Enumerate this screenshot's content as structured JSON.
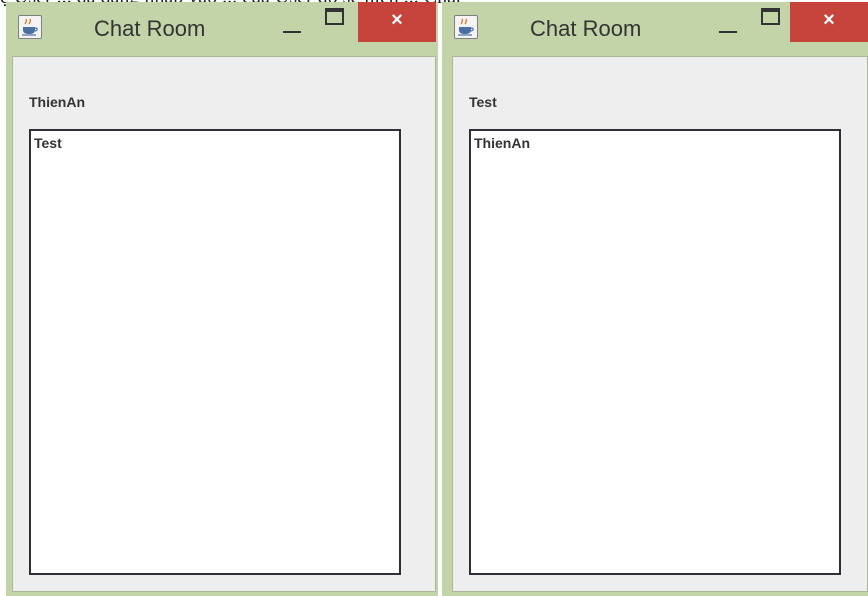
{
  "background_text": "ệ User ... đã đăng nhập vào ... của User đó sẽ hiện ... Chat",
  "close_glyph": "×",
  "windows": [
    {
      "title": "Chat Room",
      "user_label": "ThienAn",
      "messages": "Test"
    },
    {
      "title": "Chat Room",
      "user_label": "Test",
      "messages": "ThienAn"
    }
  ],
  "colors": {
    "frame": "#c2d4a8",
    "close_button": "#c7443c",
    "client_bg": "#eeeeee",
    "text_area_bg": "#ffffff"
  },
  "icons": {
    "app": "java-coffee-cup-icon",
    "minimize": "minimize-icon",
    "maximize": "maximize-icon",
    "close": "close-icon"
  }
}
